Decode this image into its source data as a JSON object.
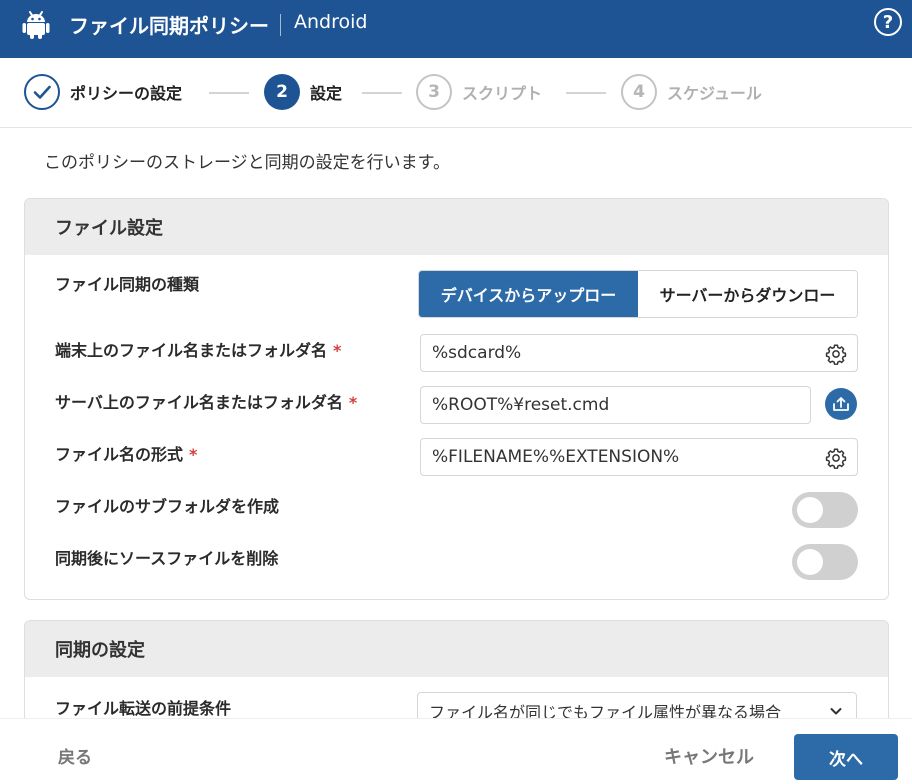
{
  "header": {
    "icon": "android-icon",
    "title": "ファイル同期ポリシー",
    "platform": "Android",
    "help_icon": "help-icon",
    "help_label": "?",
    "bg_color": "#1e5493"
  },
  "stepper": {
    "steps": [
      {
        "number": "✓",
        "label": "ポリシーの設定",
        "state": "done"
      },
      {
        "number": "2",
        "label": "設定",
        "state": "active"
      },
      {
        "number": "3",
        "label": "スクリプト",
        "state": "todo"
      },
      {
        "number": "4",
        "label": "スケジュール",
        "state": "todo"
      }
    ]
  },
  "intro": "このポリシーのストレージと同期の設定を行います。",
  "file_settings": {
    "title": "ファイル設定",
    "sync_type": {
      "label": "ファイル同期の種類",
      "options": [
        "デバイスからアップロー",
        "サーバーからダウンロー"
      ],
      "selected": 0
    },
    "device_path": {
      "label": "端末上のファイル名またはフォルダ名",
      "required_mark": "*",
      "value": "%sdcard%",
      "icon": "gear-icon"
    },
    "server_path": {
      "label": "サーバ上のファイル名またはフォルダ名",
      "required_mark": "*",
      "value": "%ROOT%¥reset.cmd",
      "icon": "upload-icon"
    },
    "filename_format": {
      "label": "ファイル名の形式",
      "required_mark": "*",
      "value": "%FILENAME%%EXTENSION%",
      "icon": "gear-icon"
    },
    "create_subfolders": {
      "label": "ファイルのサブフォルダを作成",
      "enabled": false
    },
    "delete_source": {
      "label": "同期後にソースファイルを削除",
      "enabled": false
    }
  },
  "sync_settings": {
    "title": "同期の設定",
    "transfer_condition": {
      "label": "ファイル転送の前提条件",
      "selected": "ファイル名が同じでもファイル属性が異なる場合"
    }
  },
  "footer": {
    "back_label": "戻る",
    "cancel_label": "キャンセル",
    "next_label": "次へ",
    "accent_color": "#2c6aa8"
  }
}
